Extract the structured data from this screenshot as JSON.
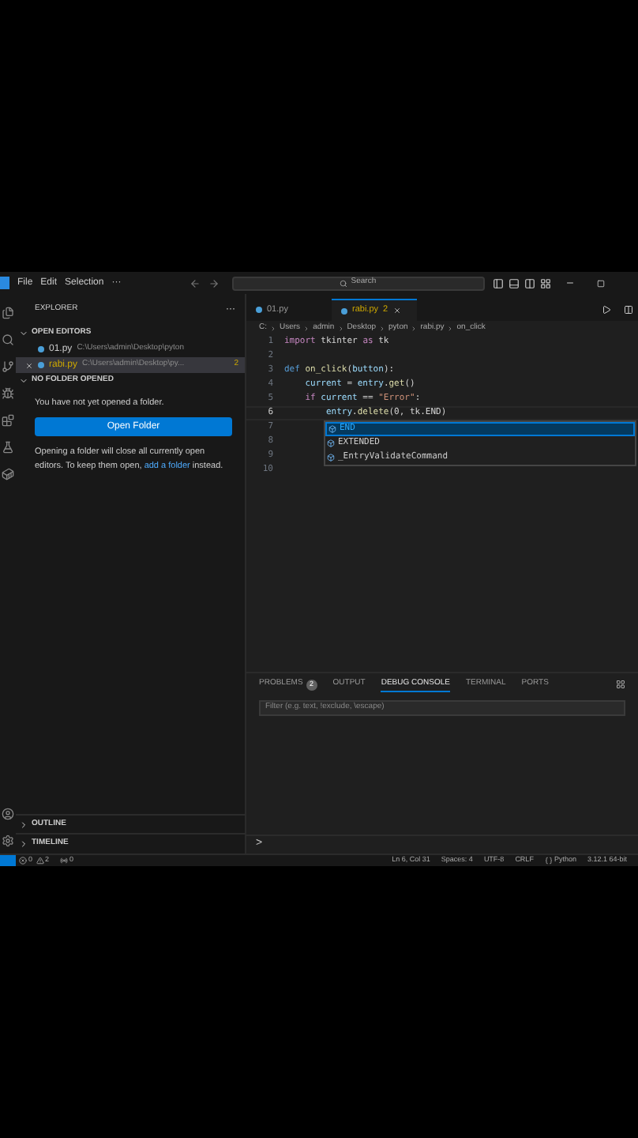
{
  "menu": [
    "File",
    "Edit",
    "Selection",
    "···"
  ],
  "search": {
    "placeholder": "Search"
  },
  "sidebar": {
    "title": "EXPLORER",
    "more": "···",
    "open_editors": {
      "title": "OPEN EDITORS",
      "expanded": true,
      "items": [
        {
          "name": "01.py",
          "path": "C:\\Users\\admin\\Desktop\\pyton",
          "selected": false
        },
        {
          "name": "rabi.py",
          "path": "C:\\Users\\admin\\Desktop\\py...",
          "badge": "2",
          "selected": true
        }
      ]
    },
    "no_folder": {
      "title": "NO FOLDER OPENED",
      "expanded": true,
      "message": "You have not yet opened a folder.",
      "button": "Open Folder",
      "note_before": "Opening a folder will close all currently open editors. To keep them open,",
      "note_link": "add a folder",
      "note_after": "instead."
    },
    "outline": {
      "title": "OUTLINE",
      "expanded": false
    },
    "timeline": {
      "title": "TIMELINE",
      "expanded": false
    }
  },
  "editor": {
    "tabs": [
      {
        "name": "01.py",
        "selected": false
      },
      {
        "name": "rabi.py",
        "badge": "2",
        "selected": true
      }
    ],
    "breadcrumb": [
      "C:",
      "Users",
      "admin",
      "Desktop",
      "pyton",
      "rabi.py",
      "on_click"
    ],
    "lines": [
      {
        "number": "1",
        "active": false,
        "tokens": [
          {
            "kind": "keyword",
            "text": "import"
          },
          {
            "kind": "plain",
            "text": " tkinter "
          },
          {
            "kind": "keyword",
            "text": "as"
          },
          {
            "kind": "plain",
            "text": " tk"
          }
        ]
      },
      {
        "number": "2",
        "active": false
      },
      {
        "number": "3",
        "active": false,
        "tokens": [
          {
            "kind": "def",
            "text": "def"
          },
          {
            "kind": "func",
            "text": " on_click"
          },
          {
            "kind": "plain",
            "text": "("
          },
          {
            "kind": "var",
            "text": "button"
          },
          {
            "kind": "plain",
            "text": "):"
          }
        ]
      },
      {
        "number": "4",
        "active": false,
        "tokens": [
          {
            "kind": "var",
            "text": "    current"
          },
          {
            "kind": "plain",
            "text": " = "
          },
          {
            "kind": "var",
            "text": "entry"
          },
          {
            "kind": "plain",
            "text": "."
          },
          {
            "kind": "func",
            "text": "get"
          },
          {
            "kind": "plain",
            "text": "()"
          }
        ]
      },
      {
        "number": "5",
        "active": false,
        "tokens": [
          {
            "kind": "keyword",
            "text": "    if"
          },
          {
            "kind": "var",
            "text": " current"
          },
          {
            "kind": "plain",
            "text": " == "
          },
          {
            "kind": "string",
            "text": "\"Error\""
          },
          {
            "kind": "plain",
            "text": ":"
          }
        ]
      },
      {
        "number": "6",
        "active": true,
        "tokens": [
          {
            "kind": "var",
            "text": "        entry"
          },
          {
            "kind": "plain",
            "text": "."
          },
          {
            "kind": "func",
            "text": "delete"
          },
          {
            "kind": "plain",
            "text": "(0, tk.END)"
          }
        ]
      },
      {
        "number": "7",
        "active": false
      },
      {
        "number": "8",
        "active": false
      },
      {
        "number": "9",
        "active": false
      },
      {
        "number": "10",
        "active": false
      }
    ],
    "suggestions": [
      {
        "label": "END",
        "selected": true
      },
      {
        "label": "EXTENDED",
        "selected": false
      },
      {
        "label": "_EntryValidateCommand",
        "selected": false
      }
    ]
  },
  "panel": {
    "tabs": [
      {
        "label": "PROBLEMS",
        "badge": "2",
        "selected": false
      },
      {
        "label": "OUTPUT",
        "selected": false
      },
      {
        "label": "DEBUG CONSOLE",
        "selected": true
      },
      {
        "label": "TERMINAL",
        "selected": false
      },
      {
        "label": "PORTS",
        "selected": false
      }
    ],
    "filter": {
      "placeholder": "Filter (e.g. text, !exclude, \\escape)"
    },
    "prompt": ">"
  },
  "status_bar": {
    "errors": "0",
    "warnings": "2",
    "ports": "0",
    "right": [
      "Ln 6, Col 31",
      "Spaces: 4",
      "UTF-8",
      "CRLF",
      "Python",
      "3.12.1 64-bit"
    ]
  }
}
